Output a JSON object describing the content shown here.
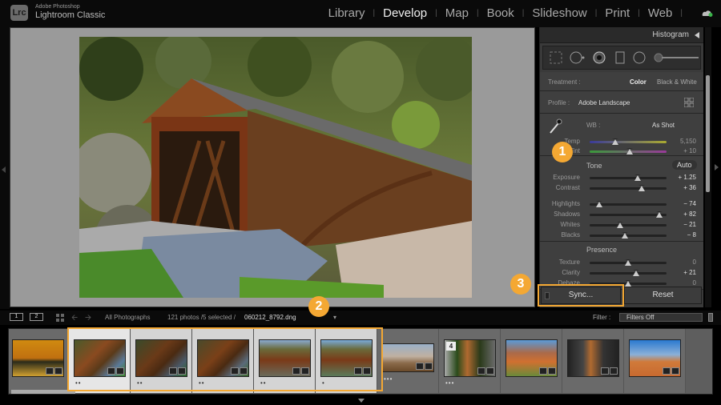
{
  "app": {
    "logo": "Lrc",
    "brand_line1": "Adobe Photoshop",
    "brand_line2": "Lightroom Classic"
  },
  "modules": [
    {
      "label": "Library",
      "active": false
    },
    {
      "label": "Develop",
      "active": true
    },
    {
      "label": "Map",
      "active": false
    },
    {
      "label": "Book",
      "active": false
    },
    {
      "label": "Slideshow",
      "active": false
    },
    {
      "label": "Print",
      "active": false
    },
    {
      "label": "Web",
      "active": false
    }
  ],
  "right_panel": {
    "histogram_title": "Histogram",
    "treatment": {
      "label": "Treatment :",
      "options": [
        "Color",
        "Black & White"
      ],
      "selected": "Color"
    },
    "profile": {
      "label": "Profile :",
      "value": "Adobe Landscape"
    },
    "wb": {
      "label": "WB :",
      "value": "As Shot"
    },
    "temp": {
      "label": "Temp",
      "value": "5,150",
      "position": 0.33
    },
    "tint": {
      "label": "Tint",
      "value": "+ 10",
      "position": 0.52
    },
    "tone": {
      "title": "Tone",
      "auto_label": "Auto"
    },
    "tone_sliders": [
      {
        "label": "Exposure",
        "value": "+ 1.25",
        "position": 0.63
      },
      {
        "label": "Contrast",
        "value": "+ 36",
        "position": 0.68
      },
      {
        "label": "Highlights",
        "value": "− 74",
        "position": 0.13
      },
      {
        "label": "Shadows",
        "value": "+ 82",
        "position": 0.91
      },
      {
        "label": "Whites",
        "value": "− 21",
        "position": 0.4
      },
      {
        "label": "Blacks",
        "value": "− 8",
        "position": 0.46
      }
    ],
    "presence": {
      "title": "Presence"
    },
    "presence_sliders": [
      {
        "label": "Texture",
        "value": "0",
        "position": 0.5
      },
      {
        "label": "Clarity",
        "value": "+ 21",
        "position": 0.6
      },
      {
        "label": "Dehaze",
        "value": "0",
        "position": 0.5
      }
    ],
    "sync_label": "Sync...",
    "reset_label": "Reset"
  },
  "filmstrip_bar": {
    "screen1": "1",
    "screen2": "2",
    "source": "All Photographs",
    "count": "121 photos /5 selected /",
    "filename": "060212_8792.dng",
    "filter_label": "Filter :",
    "filter_value": "Filters Off"
  },
  "filmstrip": [
    {
      "name": "autumn-trees",
      "dots": "",
      "selected": false
    },
    {
      "name": "covered-bridge-1",
      "dots": "••",
      "selected": true,
      "primary": true
    },
    {
      "name": "covered-bridge-2",
      "dots": "••",
      "selected": true
    },
    {
      "name": "covered-bridge-3",
      "dots": "••",
      "selected": true
    },
    {
      "name": "covered-bridge-4",
      "dots": "••",
      "selected": true
    },
    {
      "name": "covered-bridge-5",
      "dots": "•",
      "selected": true
    },
    {
      "name": "desert-hills",
      "dots": "•••",
      "selected": false
    },
    {
      "name": "horse-color",
      "dots": "•••",
      "selected": false,
      "stack": "4"
    },
    {
      "name": "hikers-canyon",
      "dots": "",
      "selected": false
    },
    {
      "name": "horse-bw",
      "dots": "",
      "selected": false
    },
    {
      "name": "hoodoos",
      "dots": "",
      "selected": false
    }
  ],
  "callouts": [
    "1",
    "2",
    "3"
  ],
  "colors": {
    "accent": "#f4a833",
    "panel": "#3f3f3f",
    "background": "#9a9a9a"
  }
}
